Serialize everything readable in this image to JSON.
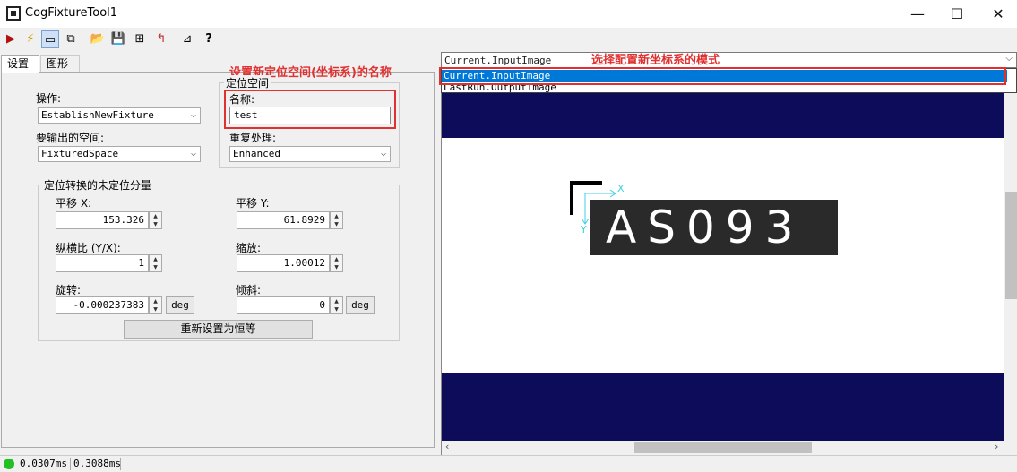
{
  "window": {
    "title": "CogFixtureTool1",
    "minimize": "—",
    "maximize": "☐",
    "close": "✕"
  },
  "toolbar": {
    "icons": [
      "run-icon",
      "electric-icon",
      "display-icon",
      "copy-icon",
      "open-icon",
      "save-icon",
      "tool-icon",
      "reset-icon",
      "calib-icon",
      "help-icon"
    ]
  },
  "tabs": [
    {
      "label": "设置"
    },
    {
      "label": "图形"
    }
  ],
  "settings": {
    "operation_label": "操作:",
    "operation_value": "EstablishNewFixture",
    "output_space_label": "要输出的空间:",
    "output_space_value": "FixturedSpace",
    "fixture_group_title": "定位空间",
    "name_label": "名称:",
    "name_value": "test",
    "repeat_label": "重复处理:",
    "repeat_value": "Enhanced",
    "transform_group_title": "定位转换的未定位分量",
    "translate_x_label": "平移 X:",
    "translate_x_value": "153.326",
    "translate_y_label": "平移 Y:",
    "translate_y_value": "61.8929",
    "aspect_label": "纵横比 (Y/X):",
    "aspect_value": "1",
    "scale_label": "缩放:",
    "scale_value": "1.00012",
    "rotation_label": "旋转:",
    "rotation_value": "-0.000237383",
    "rotation_unit": "deg",
    "skew_label": "倾斜:",
    "skew_value": "0",
    "skew_unit": "deg",
    "reset_button": "重新设置为恒等"
  },
  "annotations": {
    "left": "设置新定位空间(坐标系)的名称",
    "right": "选择配置新坐标系的模式"
  },
  "display": {
    "dropdown_value": "Current.InputImage",
    "options": [
      "Current.InputImage",
      "LastRun.OutputImage"
    ],
    "selected_option": "Current.InputImage",
    "image_text": "AS093",
    "axis_x": "X",
    "axis_y": "Y"
  },
  "status": {
    "time1": "0.0307ms",
    "time2": "0.3088ms",
    "indicator_color": "#22c022"
  }
}
